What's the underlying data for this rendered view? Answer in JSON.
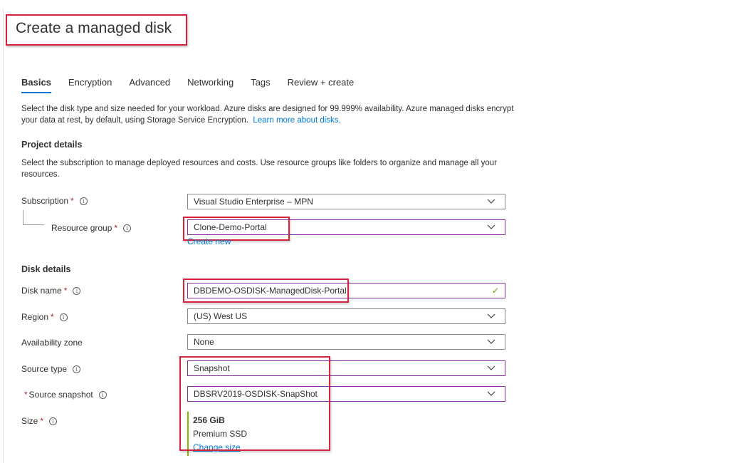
{
  "page": {
    "title": "Create a managed disk"
  },
  "tabs": [
    {
      "label": "Basics",
      "active": true
    },
    {
      "label": "Encryption",
      "active": false
    },
    {
      "label": "Advanced",
      "active": false
    },
    {
      "label": "Networking",
      "active": false
    },
    {
      "label": "Tags",
      "active": false
    },
    {
      "label": "Review + create",
      "active": false
    }
  ],
  "intro": {
    "text": "Select the disk type and size needed for your workload. Azure disks are designed for 99.999% availability. Azure managed disks encrypt your data at rest, by default, using Storage Service Encryption.",
    "link": "Learn more about disks."
  },
  "project_details": {
    "heading": "Project details",
    "description": "Select the subscription to manage deployed resources and costs. Use resource groups like folders to organize and manage all your resources.",
    "subscription": {
      "label": "Subscription",
      "required": "*",
      "value": "Visual Studio Enterprise – MPN"
    },
    "resource_group": {
      "label": "Resource group",
      "required": "*",
      "value": "Clone-Demo-Portal",
      "create_new": "Create new"
    }
  },
  "disk_details": {
    "heading": "Disk details",
    "disk_name": {
      "label": "Disk name",
      "required": "*",
      "value": "DBDEMO-OSDISK-ManagedDisk-Portal"
    },
    "region": {
      "label": "Region",
      "required": "*",
      "value": "(US) West US"
    },
    "availability_zone": {
      "label": "Availability zone",
      "value": "None"
    },
    "source_type": {
      "label": "Source type",
      "value": "Snapshot"
    },
    "source_snapshot": {
      "label": "Source snapshot",
      "required": "*",
      "value": "DBSRV2019-OSDISK-SnapShot"
    },
    "size": {
      "label": "Size",
      "required": "*",
      "value": "256 GiB",
      "tier": "Premium SSD",
      "change": "Change size"
    }
  },
  "icons": {
    "info": "i",
    "valid": "✓"
  },
  "colors": {
    "accent": "#0078d4",
    "highlight": "#d6223c",
    "focus": "#8a2da5",
    "valid": "#57a300",
    "size_bar": "#7fba00"
  }
}
